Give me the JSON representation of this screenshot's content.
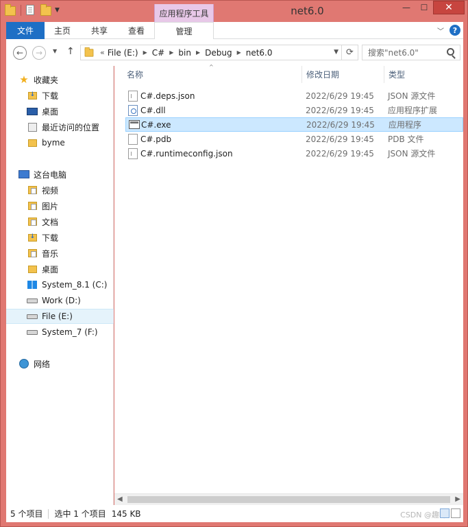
{
  "window": {
    "title": "net6.0",
    "contextual_tab": "应用程序工具"
  },
  "ribbon": {
    "tabs": [
      "文件",
      "主页",
      "共享",
      "查看",
      "管理"
    ]
  },
  "address": {
    "lead": "«",
    "crumbs": [
      "File (E:)",
      "C#",
      "bin",
      "Debug",
      "net6.0"
    ],
    "search_placeholder": "搜索\"net6.0\""
  },
  "nav": {
    "favorites_label": "收藏夹",
    "favorites": [
      "下载",
      "桌面",
      "最近访问的位置",
      "byme"
    ],
    "pc_label": "这台电脑",
    "pc_items": [
      "视频",
      "图片",
      "文档",
      "下载",
      "音乐",
      "桌面",
      "System_8.1 (C:)",
      "Work (D:)",
      "File (E:)",
      "System_7 (F:)"
    ],
    "network_label": "网络"
  },
  "columns": {
    "name": "名称",
    "date": "修改日期",
    "type": "类型"
  },
  "files": [
    {
      "name": "C#.deps.json",
      "date": "2022/6/29 19:45",
      "type": "JSON 源文件"
    },
    {
      "name": "C#.dll",
      "date": "2022/6/29 19:45",
      "type": "应用程序扩展"
    },
    {
      "name": "C#.exe",
      "date": "2022/6/29 19:45",
      "type": "应用程序"
    },
    {
      "name": "C#.pdb",
      "date": "2022/6/29 19:45",
      "type": "PDB 文件"
    },
    {
      "name": "C#.runtimeconfig.json",
      "date": "2022/6/29 19:45",
      "type": "JSON 源文件"
    }
  ],
  "status": {
    "count": "5 个项目",
    "selected": "选中 1 个项目",
    "size": "145 KB",
    "watermark": "CSDN @趣味"
  },
  "colors": {
    "window_frame": "#e07872",
    "file_tab": "#1e6fc5",
    "contextual_tab": "#e8c8e8",
    "selection": "#cce8ff"
  }
}
